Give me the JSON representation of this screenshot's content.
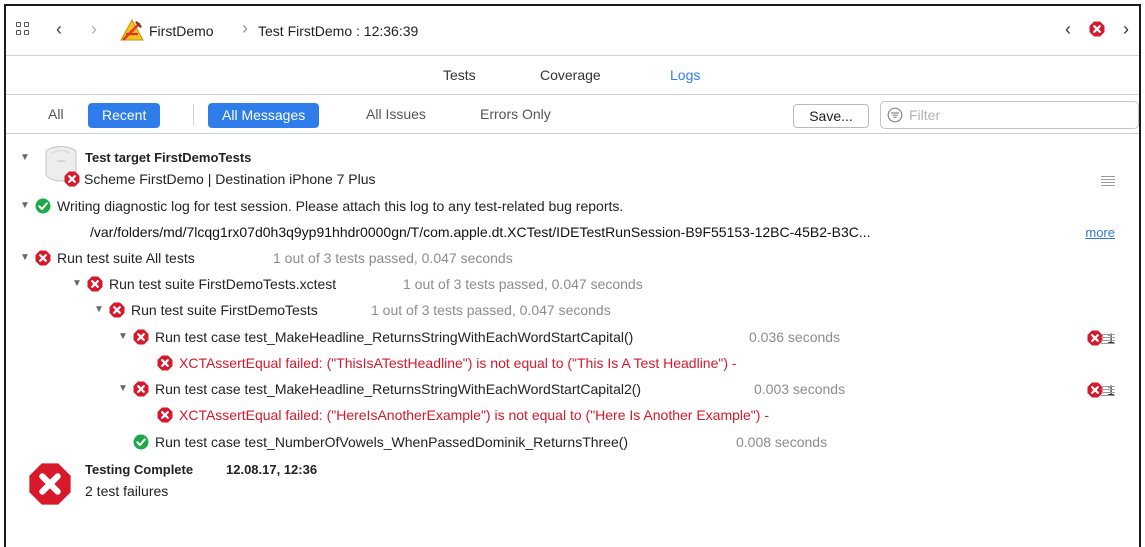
{
  "jumpbar": {
    "project": "FirstDemo",
    "report_title": "Test FirstDemo : 12:36:39"
  },
  "tabs": [
    {
      "label": "Tests",
      "active": false
    },
    {
      "label": "Coverage",
      "active": false
    },
    {
      "label": "Logs",
      "active": true
    }
  ],
  "filters": {
    "all": "All",
    "recent": "Recent",
    "all_messages": "All Messages",
    "all_issues": "All Issues",
    "errors_only": "Errors Only",
    "save": "Save...",
    "filter_placeholder": "Filter"
  },
  "log": {
    "target_title": "Test target FirstDemoTests",
    "target_detail": "Scheme FirstDemo | Destination iPhone 7 Plus",
    "diag_message": "Writing diagnostic log for test session. Please attach this log to any test-related bug reports.",
    "diag_path": "/var/folders/md/7lcqg1rx07d0h3q9yp91hhdr0000gn/T/com.apple.dt.XCTest/IDETestRunSession-B9F55153-12BC-45B2-B3C...",
    "more_label": "more",
    "suite_all": "Run test suite All tests",
    "suite_all_stats": "1 out of 3 tests passed, 0.047 seconds",
    "suite_xctest": "Run test suite FirstDemoTests.xctest",
    "suite_xctest_stats": "1 out of 3 tests passed, 0.047 seconds",
    "suite_demo": "Run test suite FirstDemoTests",
    "suite_demo_stats": "1 out of 3 tests passed, 0.047 seconds",
    "case1": "Run test case test_MakeHeadline_ReturnsStringWithEachWordStartCapital()",
    "case1_time": "0.036 seconds",
    "case1_error": "XCTAssertEqual failed: (\"ThisIsATestHeadline\") is not equal to (\"This Is A Test Headline\") -",
    "case1_count": "1",
    "case2": "Run test case test_MakeHeadline_ReturnsStringWithEachWordStartCapital2()",
    "case2_time": "0.003 seconds",
    "case2_error": "XCTAssertEqual failed: (\"HereIsAnotherExample\") is not equal to (\"Here Is Another Example\") -",
    "case2_count": "1",
    "case3": "Run test case test_NumberOfVowels_WhenPassedDominik_ReturnsThree()",
    "case3_time": "0.008 seconds",
    "complete_title": "Testing Complete",
    "complete_time": "12.08.17, 12:36",
    "complete_detail": "2 test failures"
  },
  "colors": {
    "accent": "#2f7dea",
    "error": "#d8182b",
    "success": "#1fa84a"
  }
}
